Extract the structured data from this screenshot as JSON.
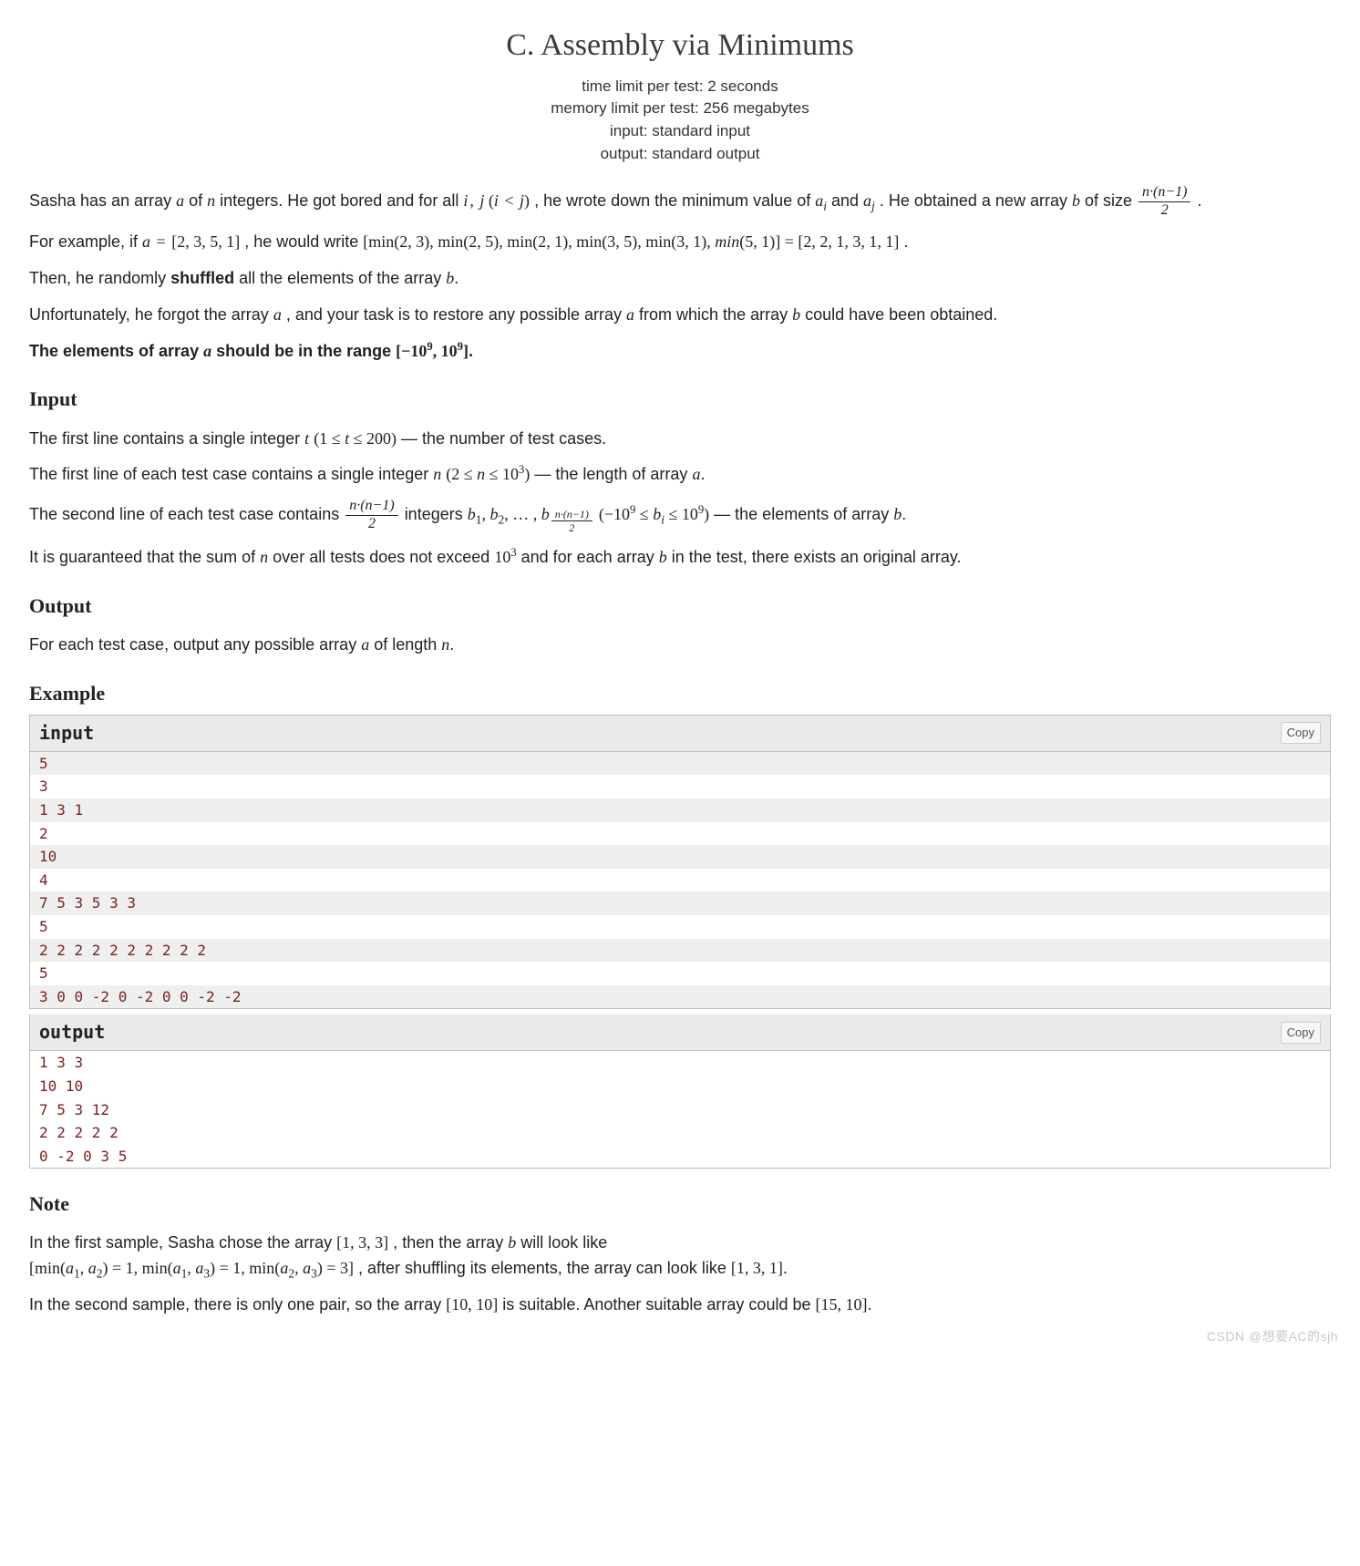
{
  "title": "C. Assembly via Minimums",
  "limits": {
    "time": "time limit per test: 2 seconds",
    "memory": "memory limit per test: 256 megabytes",
    "input": "input: standard input",
    "output": "output: standard output"
  },
  "p1_a": "Sasha has an array ",
  "p1_b": " of ",
  "p1_c": " integers. He got bored and for all ",
  "p1_d": ", he wrote down the minimum value of ",
  "p1_e": " and ",
  "p1_f": ". He obtained a new array ",
  "p1_g": " of size ",
  "p1_h": ".",
  "p2_a": "For example, if ",
  "p2_b": ", he would write ",
  "p2_c": ".",
  "p3_a": "Then, he randomly ",
  "p3_b": "shuffled",
  "p3_c": " all the elements of the array ",
  "p3_d": ".",
  "p4_a": "Unfortunately, he forgot the array ",
  "p4_b": ", and your task is to restore any possible array ",
  "p4_c": " from which the array ",
  "p4_d": " could have been obtained.",
  "p5_a": "The elements of array ",
  "p5_b": " should be in the range ",
  "p5_c": ".",
  "sec_input": "Input",
  "in1_a": "The first line contains a single integer ",
  "in1_b": " — the number of test cases.",
  "in2_a": "The first line of each test case contains a single integer ",
  "in2_b": " — the length of array ",
  "in2_c": ".",
  "in3_a": "The second line of each test case contains ",
  "in3_b": " integers ",
  "in3_c": " — the elements of array ",
  "in3_d": ".",
  "in4_a": "It is guaranteed that the sum of ",
  "in4_b": " over all tests does not exceed ",
  "in4_c": " and for each array ",
  "in4_d": " in the test, there exists an original array.",
  "sec_output": "Output",
  "out1_a": "For each test case, output any possible array ",
  "out1_b": " of length ",
  "out1_c": ".",
  "sec_example": "Example",
  "label_input": "input",
  "label_output": "output",
  "copy": "Copy",
  "example_input": [
    "5",
    "3",
    "1 3 1",
    "2",
    "10",
    "4",
    "7 5 3 5 3 3",
    "5",
    "2 2 2 2 2 2 2 2 2 2",
    "5",
    "3 0 0 -2 0 -2 0 0 -2 -2"
  ],
  "example_output": [
    "1 3 3",
    "10 10",
    "7 5 3 12",
    "2 2 2 2 2",
    "0 -2 0 3 5"
  ],
  "sec_note": "Note",
  "note1_a": "In the first sample, Sasha chose the array ",
  "note1_b": ", then the array ",
  "note1_c": " will look like ",
  "note1_d": ", after shuffling its elements, the array can look like ",
  "note1_e": ".",
  "note2_a": "In the second sample, there is only one pair, so the array ",
  "note2_b": " is suitable. Another suitable array could be ",
  "note2_c": ".",
  "watermark": "CSDN @想要AC的sjh",
  "math": {
    "a": "a",
    "b": "b",
    "n": "n",
    "t": "t",
    "i": "i",
    "j": "j",
    "ij_lt": "i, j (i < j)",
    "ai": "a_i",
    "aj": "a_j",
    "frac_num": "n·(n−1)",
    "frac_den": "2",
    "a_eq": "a = [2, 3, 5, 1]",
    "min_chain": "[min(2, 3), min(2, 5), min(2, 1), min(3, 5), min(3, 1), min(5, 1)] = [2, 2, 1, 3, 1, 1]",
    "range": "[−10^9, 10^9]",
    "t_range": "(1 ≤ t ≤ 200)",
    "n_range": "(2 ≤ n ≤ 10^3)",
    "b_list": "b_1, b_2, …, b_{n·(n−1)/2}",
    "b_range": "(−10^9 ≤ b_i ≤ 10^9)",
    "ten3": "10^3",
    "arr133": "[1, 3, 3]",
    "note_min": "[min(a_1, a_2) = 1, min(a_1, a_3) = 1, min(a_2, a_3) = 3]",
    "arr131": "[1, 3, 1]",
    "arr1010": "[10, 10]",
    "arr1510": "[15, 10]"
  }
}
